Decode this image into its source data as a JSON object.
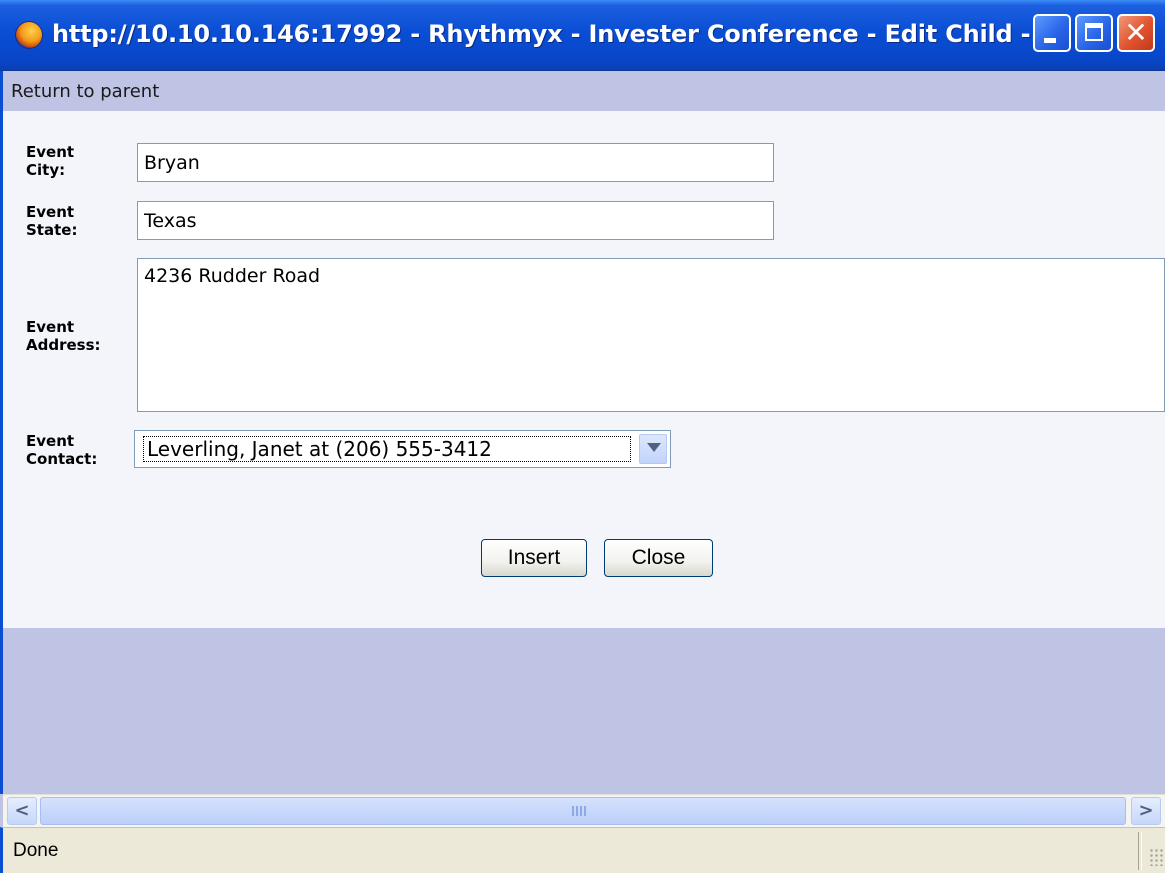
{
  "window": {
    "title": "http://10.10.10.146:17992 - Rhythmyx - Invester Conference - Edit Child -...",
    "close_glyph": "✕"
  },
  "nav": {
    "return_link": "Return to parent"
  },
  "form": {
    "city_label": "Event City:",
    "city_value": "Bryan",
    "state_label": "Event State:",
    "state_value": "Texas",
    "address_label": "Event Address:",
    "address_value": "4236 Rudder Road",
    "contact_label": "Event Contact:",
    "contact_value": "Leverling, Janet at (206) 555-3412",
    "insert_label": "Insert",
    "close_label": "Close"
  },
  "scrollbar": {
    "left_glyph": "<",
    "right_glyph": ">"
  },
  "status": {
    "text": "Done"
  }
}
